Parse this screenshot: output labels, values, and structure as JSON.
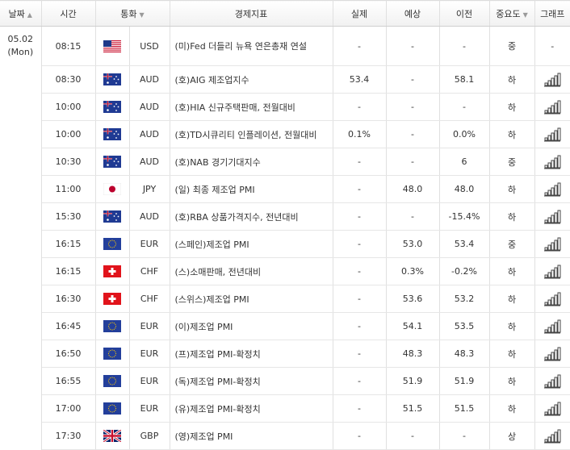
{
  "headers": {
    "date": "날짜",
    "time": "시간",
    "currency": "통화",
    "event": "경제지표",
    "actual": "실제",
    "forecast": "예상",
    "previous": "이전",
    "importance": "중요도",
    "graph": "그래프"
  },
  "date_label": "05.02",
  "day_label": "(Mon)",
  "colors": {
    "up_bull": "#333333",
    "header_bg": "#f1f1f1"
  },
  "rows": [
    {
      "time": "08:15",
      "flag": "us",
      "currency": "USD",
      "event": "(미)Fed 더들리 뉴욕 연은총재 연설",
      "actual": "-",
      "forecast": "-",
      "previous": "-",
      "importance": "중",
      "graph": "-"
    },
    {
      "time": "08:30",
      "flag": "au",
      "currency": "AUD",
      "event": "(호)AIG 제조업지수",
      "actual": "53.4",
      "forecast": "-",
      "previous": "58.1",
      "importance": "하",
      "graph": "bar-chart-icon"
    },
    {
      "time": "10:00",
      "flag": "au",
      "currency": "AUD",
      "event": "(호)HIA 신규주택판매, 전월대비",
      "actual": "-",
      "forecast": "-",
      "previous": "-",
      "importance": "하",
      "graph": "bar-chart-icon"
    },
    {
      "time": "10:00",
      "flag": "au",
      "currency": "AUD",
      "event": "(호)TD시큐리티 인플레이션, 전월대비",
      "actual": "0.1%",
      "forecast": "-",
      "previous": "0.0%",
      "importance": "하",
      "graph": "bar-chart-icon"
    },
    {
      "time": "10:30",
      "flag": "au",
      "currency": "AUD",
      "event": "(호)NAB 경기기대지수",
      "actual": "-",
      "forecast": "-",
      "previous": "6",
      "importance": "중",
      "graph": "bar-chart-icon"
    },
    {
      "time": "11:00",
      "flag": "jp",
      "currency": "JPY",
      "event": "(일) 최종 제조업 PMI",
      "actual": "-",
      "forecast": "48.0",
      "previous": "48.0",
      "importance": "하",
      "graph": "bar-chart-icon"
    },
    {
      "time": "15:30",
      "flag": "au",
      "currency": "AUD",
      "event": "(호)RBA 상품가격지수, 전년대비",
      "actual": "-",
      "forecast": "-",
      "previous": "-15.4%",
      "importance": "하",
      "graph": "bar-chart-icon"
    },
    {
      "time": "16:15",
      "flag": "eu",
      "currency": "EUR",
      "event": "(스페인)제조업 PMI",
      "actual": "-",
      "forecast": "53.0",
      "previous": "53.4",
      "importance": "중",
      "graph": "bar-chart-icon"
    },
    {
      "time": "16:15",
      "flag": "ch",
      "currency": "CHF",
      "event": "(스)소매판매, 전년대비",
      "actual": "-",
      "forecast": "0.3%",
      "previous": "-0.2%",
      "importance": "하",
      "graph": "bar-chart-icon"
    },
    {
      "time": "16:30",
      "flag": "ch",
      "currency": "CHF",
      "event": "(스위스)제조업 PMI",
      "actual": "-",
      "forecast": "53.6",
      "previous": "53.2",
      "importance": "하",
      "graph": "bar-chart-icon"
    },
    {
      "time": "16:45",
      "flag": "eu",
      "currency": "EUR",
      "event": "(이)제조업 PMI",
      "actual": "-",
      "forecast": "54.1",
      "previous": "53.5",
      "importance": "하",
      "graph": "bar-chart-icon"
    },
    {
      "time": "16:50",
      "flag": "eu",
      "currency": "EUR",
      "event": "(프)제조업 PMI-확정치",
      "actual": "-",
      "forecast": "48.3",
      "previous": "48.3",
      "importance": "하",
      "graph": "bar-chart-icon"
    },
    {
      "time": "16:55",
      "flag": "eu",
      "currency": "EUR",
      "event": "(독)제조업 PMI-확정치",
      "actual": "-",
      "forecast": "51.9",
      "previous": "51.9",
      "importance": "하",
      "graph": "bar-chart-icon"
    },
    {
      "time": "17:00",
      "flag": "eu",
      "currency": "EUR",
      "event": "(유)제조업 PMI-확정치",
      "actual": "-",
      "forecast": "51.5",
      "previous": "51.5",
      "importance": "하",
      "graph": "bar-chart-icon"
    },
    {
      "time": "17:30",
      "flag": "gb",
      "currency": "GBP",
      "event": "(영)제조업 PMI",
      "actual": "-",
      "forecast": "-",
      "previous": "-",
      "importance": "상",
      "graph": "bar-chart-icon"
    }
  ]
}
